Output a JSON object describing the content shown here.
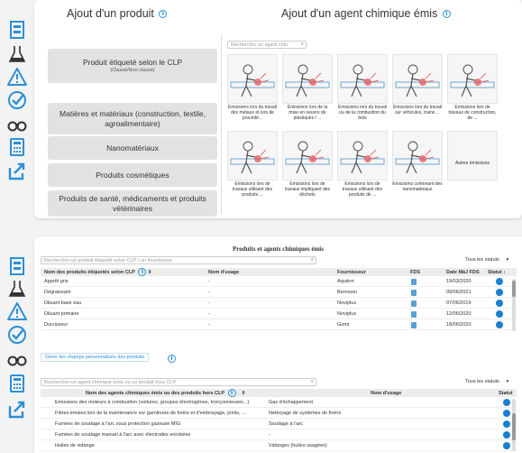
{
  "top": {
    "product_title": "Ajout d'un produit",
    "agent_title": "Ajout d'un agent chimique émis",
    "buttons": [
      {
        "label": "Produit étiqueté selon le CLP",
        "sub": "(Classé/Non classé)"
      },
      {
        "label": "Matières et matériaux (construction, textile, agroalimentaire)",
        "sub": ""
      },
      {
        "label": "Nanomatériaux",
        "sub": ""
      },
      {
        "label": "Produits cosmétiques",
        "sub": ""
      },
      {
        "label": "Produits de santé, médicaments et produits vétérinaires",
        "sub": ""
      }
    ],
    "agent_search_placeholder": "Rechercher un agent chin",
    "tiles": [
      {
        "label": "Emissions lors du travail des métaux et lors de procédé...",
        "icon": "welding-icon"
      },
      {
        "label": "Emissions lors de la mise en oeuvre de plastiques / ...",
        "icon": "plastic-work-icon"
      },
      {
        "label": "Emissions lors du travail ou de la combustion du bois",
        "icon": "wood-work-icon"
      },
      {
        "label": "Emissions lors du travail sur véhicules, trains ...",
        "icon": "vehicle-work-icon"
      },
      {
        "label": "Emissions lors de travaux de construction, de ...",
        "icon": "construction-icon"
      },
      {
        "label": "Emissions lors de travaux utilisant des produits ...",
        "icon": "spray-icon"
      },
      {
        "label": "Emissions lors de travaux impliquant des déchets",
        "icon": "waste-icon"
      },
      {
        "label": "Emissions lors de travaux utilisant des produits de ...",
        "icon": "cleaning-icon"
      },
      {
        "label": "Emissions contenant des nanomatériaux",
        "icon": "nano-icon"
      },
      {
        "label": "Autres émissions",
        "icon": "other-icon"
      }
    ]
  },
  "bottom": {
    "title": "Produits et agents chimiques émis",
    "product_search_placeholder": "Rechercher un produit étiqueté selon CLP / un fournisseur",
    "status_filter": "Tous les statuts",
    "products_headers": {
      "name": "Nom des produits étiquetés selon CLP",
      "usage": "Nom d'usage",
      "supplier": "Fournisseur",
      "fds": "FDS",
      "date": "Date MàJ FDS",
      "status": "Statut"
    },
    "products": [
      {
        "name": "Apprêt gris",
        "usage": "-",
        "supplier": "Aquiton",
        "date": "19/03/2020"
      },
      {
        "name": "Dégraissant",
        "usage": "-",
        "supplier": "Bernover",
        "date": "09/06/2021"
      },
      {
        "name": "Diluant base eau",
        "usage": "-",
        "supplier": "Noviplus",
        "date": "07/06/2019"
      },
      {
        "name": "Diluant primaire",
        "usage": "-",
        "supplier": "Noviplus",
        "date": "12/06/2020"
      },
      {
        "name": "Durcisseur",
        "usage": "-",
        "supplier": "Gomi",
        "date": "18/06/2020"
      }
    ],
    "custom_fields_button": "Gérer les champs personnalisés des produits",
    "agent_search_placeholder": "Rechercher un agent chimique émis ou un produit hors CLP",
    "agents_headers": {
      "name": "Nom des agents chimiques émis ou des produits hors CLP",
      "usage": "Nom d'usage",
      "status": "Statut"
    },
    "agents": [
      {
        "name": "Emissions des moteurs à combustion (voitures, groupes électrogènes, tronçonneuses...)",
        "usage": "Gaz d'échappement"
      },
      {
        "name": "Fibres émises lors de la maintenance sur garnitures de freins et d'embrayage, joints, ...",
        "usage": "Nettoyage de systèmes de freins"
      },
      {
        "name": "Fumées de soudage à l'arc sous protection gazeuse MIG",
        "usage": "Soudage à l'arc"
      },
      {
        "name": "Fumées de soudage manuel à l'arc avec électrodes enrobées",
        "usage": "-"
      },
      {
        "name": "Huiles de vidange",
        "usage": "Vidanges (huiles usagées)"
      }
    ]
  },
  "colors": {
    "accent": "#2d8fd8",
    "status_dot": "#1a7fd1",
    "sidebar_icon": "#2d8fd8"
  }
}
